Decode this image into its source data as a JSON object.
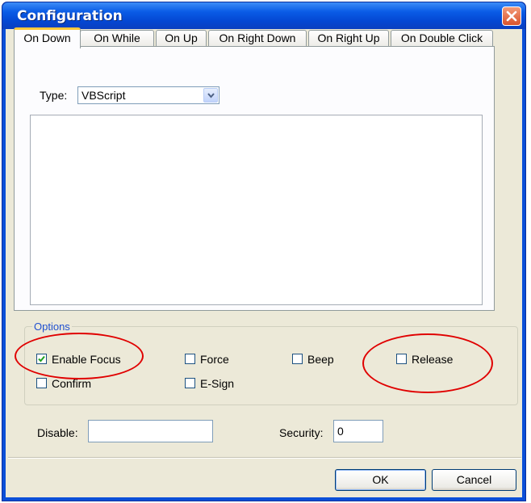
{
  "window": {
    "title": "Configuration",
    "close_icon": "close-icon"
  },
  "tabs": [
    {
      "label": "On Down",
      "active": true
    },
    {
      "label": "On While",
      "active": false
    },
    {
      "label": "On Up",
      "active": false
    },
    {
      "label": "On Right Down",
      "active": false
    },
    {
      "label": "On Right Up",
      "active": false
    },
    {
      "label": "On Double Click",
      "active": false
    }
  ],
  "type": {
    "label": "Type:",
    "selected": "VBScript"
  },
  "script": {
    "value": ""
  },
  "options": {
    "label": "Options",
    "enable_focus": {
      "label": "Enable Focus",
      "checked": true
    },
    "force": {
      "label": "Force",
      "checked": false
    },
    "beep": {
      "label": "Beep",
      "checked": false
    },
    "release": {
      "label": "Release",
      "checked": false
    },
    "confirm": {
      "label": "Confirm",
      "checked": false
    },
    "esign": {
      "label": "E-Sign",
      "checked": false
    }
  },
  "disable": {
    "label": "Disable:",
    "value": ""
  },
  "security": {
    "label": "Security:",
    "value": "0"
  },
  "buttons": {
    "ok": "OK",
    "cancel": "Cancel"
  },
  "colors": {
    "title_bar": "#0a5ce6",
    "tab_accent": "#ffc83c",
    "annotation_circle": "#e00000",
    "group_label": "#2050d0"
  }
}
